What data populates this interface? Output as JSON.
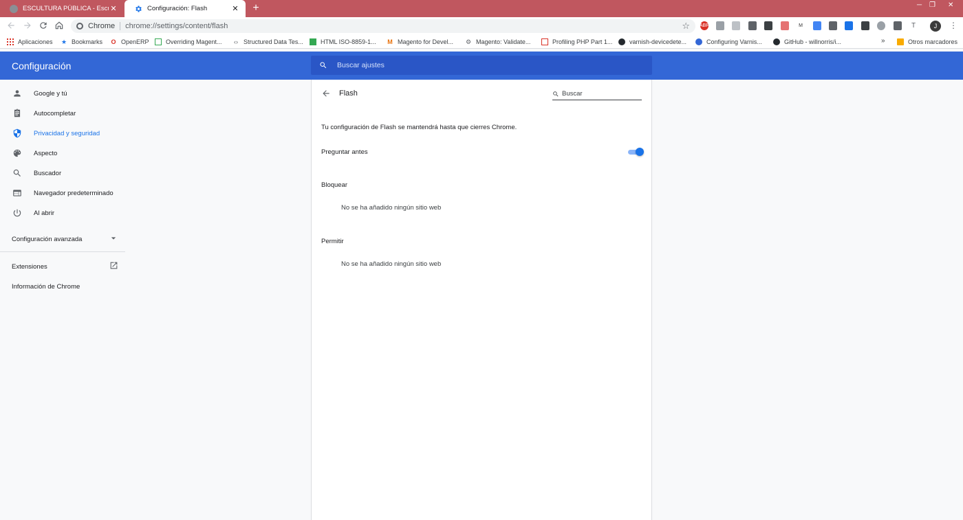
{
  "browser": {
    "tabs": [
      {
        "title": "ESCULTURA PÚBLICA - Escultura",
        "active": false
      },
      {
        "title": "Configuración: Flash",
        "active": true
      }
    ],
    "new_tab_symbol": "+",
    "window_controls": {
      "minimize": "─",
      "maximize": "❐",
      "close": "✕"
    },
    "address_bar": {
      "chip": "Chrome",
      "url": "chrome://settings/content/flash"
    },
    "avatar_initial": "J",
    "bookmarks": [
      {
        "label": "Aplicaciones",
        "icon": "apps-grid-icon"
      },
      {
        "label": "Bookmarks",
        "icon": "star-icon"
      },
      {
        "label": "OpenERP",
        "icon": "opera-icon"
      },
      {
        "label": "Overriding Magent...",
        "icon": "magento-page-icon"
      },
      {
        "label": "Structured Data Tes...",
        "icon": "code-icon"
      },
      {
        "label": "HTML ISO-8859-1...",
        "icon": "html-icon"
      },
      {
        "label": "Magento for Devel...",
        "icon": "magento-icon"
      },
      {
        "label": "Magento: Validate...",
        "icon": "gear-icon"
      },
      {
        "label": "Profiling PHP Part 1...",
        "icon": "chart-icon"
      },
      {
        "label": "varnish-devicedete...",
        "icon": "github-icon"
      },
      {
        "label": "Configuring Varnis...",
        "icon": "varnish-icon"
      },
      {
        "label": "GitHub - willnorris/i...",
        "icon": "github-icon"
      }
    ],
    "bookmarks_more": "»",
    "other_bookmarks": "Otros marcadores"
  },
  "settings": {
    "header_title": "Configuración",
    "search_placeholder": "Buscar ajustes",
    "sidebar": {
      "items": [
        {
          "label": "Google y tú",
          "icon": "person-icon",
          "selected": false
        },
        {
          "label": "Autocompletar",
          "icon": "clipboard-icon",
          "selected": false
        },
        {
          "label": "Privacidad y seguridad",
          "icon": "shield-icon",
          "selected": true
        },
        {
          "label": "Aspecto",
          "icon": "palette-icon",
          "selected": false
        },
        {
          "label": "Buscador",
          "icon": "search-icon",
          "selected": false
        },
        {
          "label": "Navegador predeterminado",
          "icon": "browser-window-icon",
          "selected": false
        },
        {
          "label": "Al abrir",
          "icon": "power-icon",
          "selected": false
        }
      ],
      "advanced": "Configuración avanzada",
      "extensions": "Extensiones",
      "about": "Información de Chrome"
    },
    "page": {
      "title": "Flash",
      "search_placeholder": "Buscar",
      "description": "Tu configuración de Flash se mantendrá hasta que cierres Chrome.",
      "toggle_label": "Preguntar antes",
      "toggle_on": true,
      "block_heading": "Bloquear",
      "block_empty": "No se ha añadido ningún sitio web",
      "allow_heading": "Permitir",
      "allow_empty": "No se ha añadido ningún sitio web"
    }
  },
  "colors": {
    "accent": "#3367d6",
    "tabstrip": "#c0575f",
    "selected": "#1a73e8"
  }
}
